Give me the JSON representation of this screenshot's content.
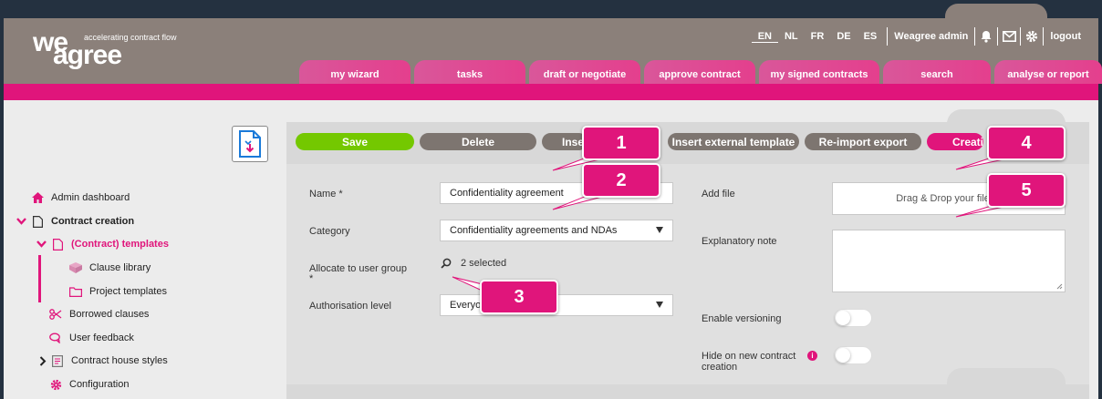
{
  "header": {
    "logo": {
      "we": "we",
      "agree": "agree",
      "tagline": "accelerating contract flow"
    },
    "languages": [
      "EN",
      "NL",
      "FR",
      "DE",
      "ES"
    ],
    "active_language": "EN",
    "user": "Weagree admin",
    "logout": "logout",
    "icons": [
      "bell-icon",
      "mail-icon",
      "gear-icon"
    ]
  },
  "tabs": [
    "my wizard",
    "tasks",
    "draft or negotiate",
    "approve contract",
    "my signed contracts",
    "search",
    "analyse or report"
  ],
  "sidebar": {
    "items": [
      {
        "label": "Admin dashboard",
        "icon": "home-icon"
      },
      {
        "label": "Contract creation",
        "icon": "document-icon"
      },
      {
        "label": "(Contract) templates",
        "icon": "document-icon"
      },
      {
        "label": "Clause library",
        "icon": "blocks-icon"
      },
      {
        "label": "Project templates",
        "icon": "folder-icon"
      },
      {
        "label": "Borrowed clauses",
        "icon": "scissors-icon"
      },
      {
        "label": "User feedback",
        "icon": "chat-icon"
      },
      {
        "label": "Contract house styles",
        "icon": "style-icon"
      },
      {
        "label": "Configuration",
        "icon": "gear-icon"
      }
    ]
  },
  "toolbar": {
    "save": "Save",
    "delete": "Delete",
    "insert": "Inse",
    "insert_external": "Insert external template",
    "reimport": "Re-import export",
    "create": "Creati"
  },
  "form": {
    "name_label": "Name *",
    "name_value": "Confidentiality agreement",
    "category_label": "Category",
    "category_value": "Confidentiality agreements and NDAs",
    "allocate_label": "Allocate to user group",
    "allocate_required": "*",
    "allocate_value": "2 selected",
    "auth_label": "Authorisation level",
    "auth_value": "Everyo",
    "add_file_label": "Add file",
    "add_file_placeholder": "Drag & Drop your file or",
    "note_label": "Explanatory note",
    "versioning_label": "Enable versioning",
    "hide_label": "Hide on new contract creation"
  },
  "callouts": [
    "1",
    "2",
    "3",
    "4",
    "5"
  ],
  "colors": {
    "brand_pink": "#e0157b",
    "header_grey": "#8b807a",
    "save_green": "#74c800",
    "button_grey": "#7d7570"
  }
}
